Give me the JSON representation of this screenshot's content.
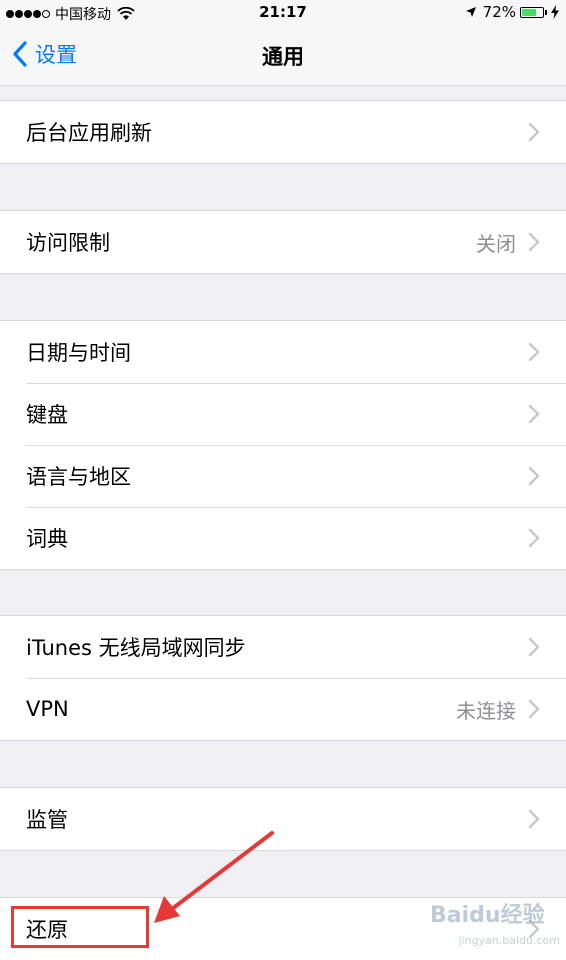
{
  "status_bar": {
    "carrier": "中国移动",
    "time": "21:17",
    "battery_percent": "72%",
    "battery_level": 0.72
  },
  "nav": {
    "back_label": "设置",
    "title": "通用"
  },
  "groups": [
    {
      "rows": [
        {
          "label": "后台应用刷新",
          "value": ""
        }
      ]
    },
    {
      "rows": [
        {
          "label": "访问限制",
          "value": "关闭"
        }
      ]
    },
    {
      "rows": [
        {
          "label": "日期与时间",
          "value": ""
        },
        {
          "label": "键盘",
          "value": ""
        },
        {
          "label": "语言与地区",
          "value": ""
        },
        {
          "label": "词典",
          "value": ""
        }
      ]
    },
    {
      "rows": [
        {
          "label": "iTunes 无线局域网同步",
          "value": ""
        },
        {
          "label": "VPN",
          "value": "未连接"
        }
      ]
    },
    {
      "rows": [
        {
          "label": "监管",
          "value": ""
        }
      ]
    },
    {
      "rows": [
        {
          "label": "还原",
          "value": ""
        }
      ]
    }
  ],
  "watermark": {
    "logo_text": "Baidu经验",
    "url": "jingyan.baidu.com"
  },
  "colors": {
    "accent": "#007aff",
    "annotation": "#e53935",
    "battery": "#4cd964"
  },
  "icons": {
    "back": "chevron-left-icon",
    "row": "chevron-right-icon",
    "wifi": "wifi-icon",
    "location": "location-arrow-icon",
    "charging": "charging-bolt-icon"
  }
}
